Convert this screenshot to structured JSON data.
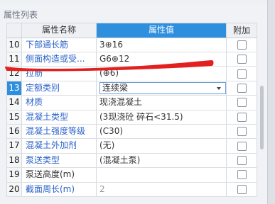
{
  "panel": {
    "title": "属性列表"
  },
  "header": {
    "name": "属性名称",
    "value": "属性值",
    "add": "附加"
  },
  "rows": [
    {
      "num": "10",
      "name": "下部通长筋",
      "name_color": "blue",
      "value": "3⊕16",
      "value_color": "black"
    },
    {
      "num": "11",
      "name": "侧面构造或受...",
      "name_color": "blue",
      "value": "G6⊕12",
      "value_color": "black"
    },
    {
      "num": "12",
      "name": "拉筋",
      "name_color": "blue",
      "value": "(⊕6)",
      "value_color": "black"
    },
    {
      "num": "13",
      "name": "定额类别",
      "name_color": "blue",
      "value": "连续梁",
      "value_color": "black",
      "dropdown": true,
      "selected": true
    },
    {
      "num": "14",
      "name": "材质",
      "name_color": "blue",
      "value": "现浇混凝土",
      "value_color": "black"
    },
    {
      "num": "15",
      "name": "混凝土类型",
      "name_color": "blue",
      "value": "(3现浇砼 碎石<31.5)",
      "value_color": "black"
    },
    {
      "num": "16",
      "name": "混凝土强度等级",
      "name_color": "blue",
      "value": "(C30)",
      "value_color": "black"
    },
    {
      "num": "17",
      "name": "混凝土外加剂",
      "name_color": "blue",
      "value": "(无)",
      "value_color": "black"
    },
    {
      "num": "18",
      "name": "泵送类型",
      "name_color": "blue",
      "value": "(混凝土泵)",
      "value_color": "black"
    },
    {
      "num": "19",
      "name": "泵送高度(m)",
      "name_color": "black",
      "value": "",
      "value_color": "black"
    },
    {
      "num": "20",
      "name": "截面周长(m)",
      "name_color": "blue",
      "value": "2",
      "value_color": "gray"
    }
  ],
  "colors": {
    "header_value_bg": "#2f8fdf",
    "name_blue": "#2a62c9",
    "annotation_red": "#e32020"
  }
}
